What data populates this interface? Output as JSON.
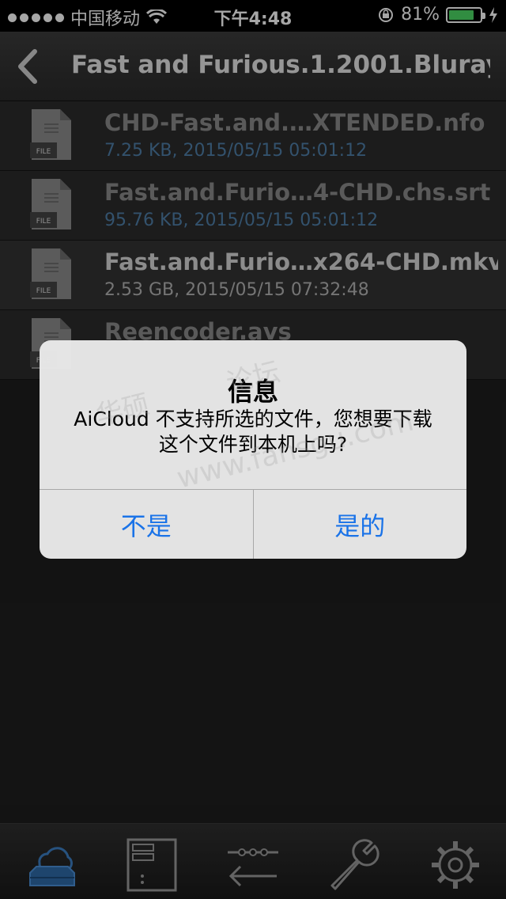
{
  "status_bar": {
    "carrier": "中国移动",
    "time": "下午4:48",
    "battery_percent": "81%",
    "battery_level": 0.81,
    "signal_icon": "signal-dots-icon",
    "wifi_icon": "wifi-icon",
    "lock_icon": "rotation-lock-icon",
    "charging_icon": "charging-bolt-icon"
  },
  "nav": {
    "title": "Fast and Furious.1.2001.Bluray.…",
    "back_icon": "chevron-left-icon"
  },
  "files": [
    {
      "name": "CHD-Fast.and.…XTENDED.nfo",
      "meta": "7.25 KB, 2015/05/15 05:01:12",
      "icon_label": "FILE"
    },
    {
      "name": "Fast.and.Furio…4-CHD.chs.srt",
      "meta": "95.76 KB, 2015/05/15 05:01:12",
      "icon_label": "FILE"
    },
    {
      "name": "Fast.and.Furio…x264-CHD.mkv",
      "meta": "2.53 GB, 2015/05/15 07:32:48",
      "icon_label": "FILE"
    },
    {
      "name": "Reencoder.avs",
      "meta": "",
      "icon_label": "FILE"
    }
  ],
  "alert": {
    "title": "信息",
    "message": "AiCloud 不支持所选的文件，您想要下载这个文件到本机上吗?",
    "cancel_label": "不是",
    "confirm_label": "是的"
  },
  "watermark": {
    "line1": "华硕",
    "line1b": "论坛",
    "line2": "www.fansgu.com"
  },
  "tabs": [
    {
      "icon": "cloud-disk-icon",
      "active": true
    },
    {
      "icon": "server-icon",
      "active": false
    },
    {
      "icon": "transfer-icon",
      "active": false
    },
    {
      "icon": "wrench-icon",
      "active": false
    },
    {
      "icon": "gear-icon",
      "active": false
    }
  ],
  "colors": {
    "accent_blue": "#1a73e8",
    "meta_blue": "#4f7ea8",
    "battery_green": "#4cd964"
  }
}
